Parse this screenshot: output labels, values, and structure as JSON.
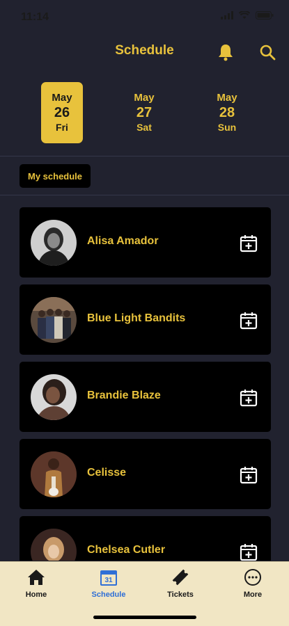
{
  "status": {
    "time": "11:14"
  },
  "header": {
    "title": "Schedule",
    "bell_icon": "bell-icon",
    "search_icon": "search-icon"
  },
  "days": [
    {
      "month": "May",
      "num": "26",
      "weekday": "Fri",
      "active": true
    },
    {
      "month": "May",
      "num": "27",
      "weekday": "Sat",
      "active": false
    },
    {
      "month": "May",
      "num": "28",
      "weekday": "Sun",
      "active": false
    }
  ],
  "filter": {
    "label": "My schedule"
  },
  "artists": [
    {
      "name": "Alisa Amador"
    },
    {
      "name": "Blue Light Bandits"
    },
    {
      "name": "Brandie Blaze"
    },
    {
      "name": "Celisse"
    },
    {
      "name": "Chelsea Cutler"
    }
  ],
  "tabs": [
    {
      "label": "Home",
      "icon": "home-icon"
    },
    {
      "label": "Schedule",
      "icon": "calendar-icon",
      "icon_text": "31",
      "active": true
    },
    {
      "label": "Tickets",
      "icon": "ticket-icon"
    },
    {
      "label": "More",
      "icon": "more-icon"
    }
  ],
  "colors": {
    "accent": "#e8c23c",
    "background": "#21222f",
    "card": "#000000",
    "tabbar": "#f1e6c4",
    "active_tab": "#2f6fd6"
  }
}
